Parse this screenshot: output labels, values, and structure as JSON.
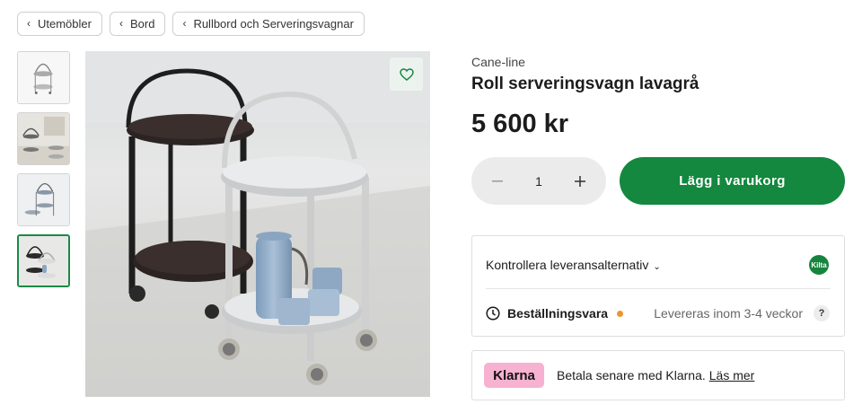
{
  "breadcrumbs": [
    {
      "label": "Utemöbler"
    },
    {
      "label": "Bord"
    },
    {
      "label": "Rullbord och Serveringsvagnar"
    }
  ],
  "product": {
    "brand": "Cane-line",
    "title": "Roll serveringsvagn lavagrå",
    "price": "5 600 kr"
  },
  "quantity": {
    "value": "1"
  },
  "cart": {
    "label": "Lägg i varukorg"
  },
  "delivery": {
    "check_label": "Kontrollera leveransalternativ",
    "store_badge": "Kilta",
    "order_type": "Beställningsvara",
    "lead_time": "Levereras inom 3-4 veckor",
    "help_symbol": "?"
  },
  "klarna": {
    "logo": "Klarna",
    "text": "Betala senare med Klarna.",
    "link": "Läs mer"
  },
  "colors": {
    "accent_green": "#13883e",
    "klarna_pink": "#f6b2d0",
    "status_dot": "#f0932b"
  },
  "gallery": {
    "thumb_count": 4,
    "active_index": 3
  }
}
